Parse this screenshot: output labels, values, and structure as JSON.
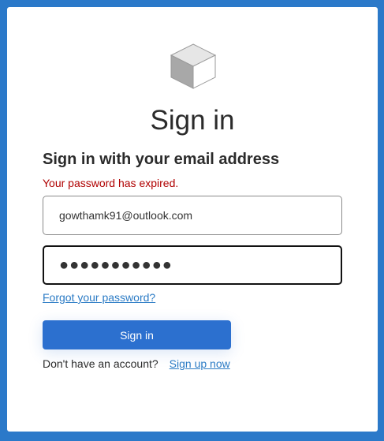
{
  "header": {
    "logo_icon": "cube-icon",
    "title": "Sign in",
    "subtitle": "Sign in with your email address"
  },
  "error_message": "Your password has expired.",
  "form": {
    "email_value": "gowthamk91@outlook.com",
    "password_value": "●●●●●●●●●●●"
  },
  "links": {
    "forgot_password": "Forgot your password?",
    "no_account": "Don't have an account?",
    "sign_up": "Sign up now"
  },
  "buttons": {
    "sign_in": "Sign in"
  },
  "colors": {
    "background": "#2b79c9",
    "primary_button": "#2c70cf",
    "link": "#2b7bc5",
    "error": "#b00000"
  }
}
